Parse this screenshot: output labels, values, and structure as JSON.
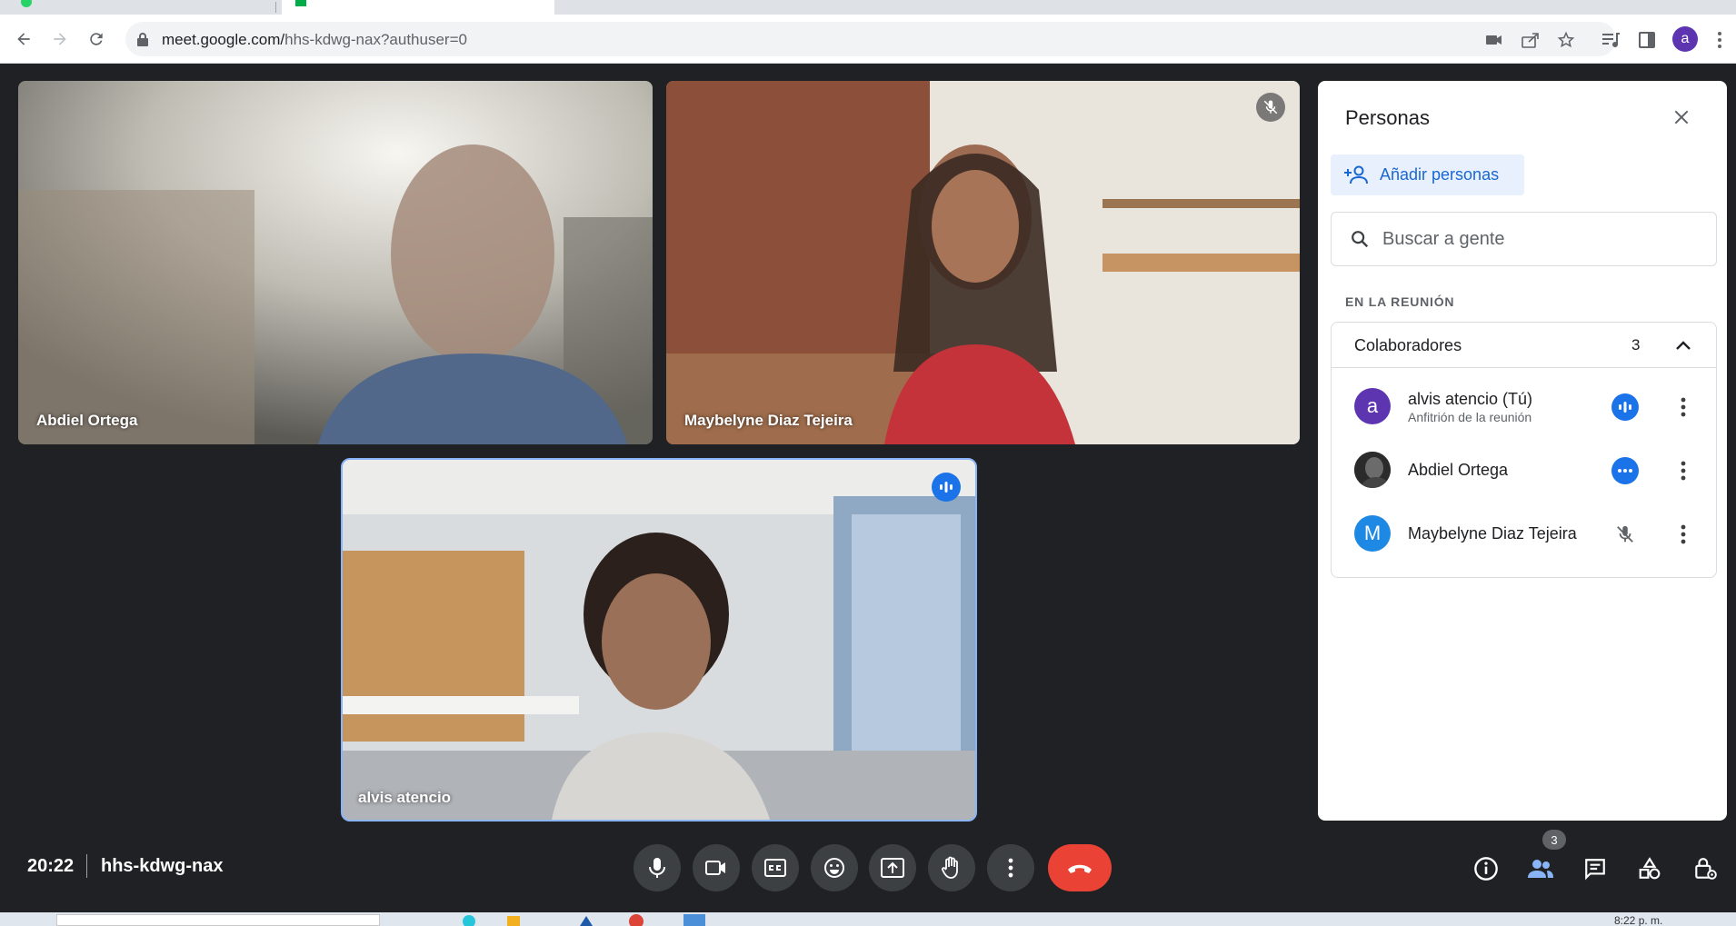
{
  "browser": {
    "url_host": "meet.google.com/",
    "url_path": "hhs-kdwg-nax?authuser=0",
    "profile_initial": "a",
    "toolbar_icons": [
      "camera-blocked-icon",
      "share-icon",
      "bookmark-star-icon",
      "media-control-icon",
      "side-panel-icon",
      "profile-avatar",
      "kebab-menu-icon"
    ]
  },
  "tiles": [
    {
      "name": "Abdiel Ortega"
    },
    {
      "name": "Maybelyne Diaz Tejeira",
      "muted": true
    },
    {
      "name": "alvis atencio",
      "speaking": true
    }
  ],
  "panel": {
    "title": "Personas",
    "add_label": "Añadir personas",
    "search_placeholder": "Buscar a gente",
    "section_label": "EN LA REUNIÓN",
    "group_label": "Colaboradores",
    "group_count": "3",
    "participants": [
      {
        "name": "alvis atencio (Tú)",
        "subtitle": "Anfitrión de la reunión",
        "initial": "a",
        "avatar_color": "#5e35b1",
        "status": "speaking"
      },
      {
        "name": "Abdiel Ortega",
        "initial": "",
        "avatar_color": "#2b2b2b",
        "status": "more"
      },
      {
        "name": "Maybelyne Diaz Tejeira",
        "initial": "M",
        "avatar_color": "#1e88e5",
        "status": "muted"
      }
    ]
  },
  "meeting": {
    "time": "20:22",
    "code": "hhs-kdwg-nax",
    "people_count": "3"
  },
  "taskbar": {
    "clock": "8:22 p. m."
  },
  "colors": {
    "accent": "#1a73e8",
    "end_call": "#ea4335",
    "background": "#202124",
    "control": "#3c4043"
  }
}
